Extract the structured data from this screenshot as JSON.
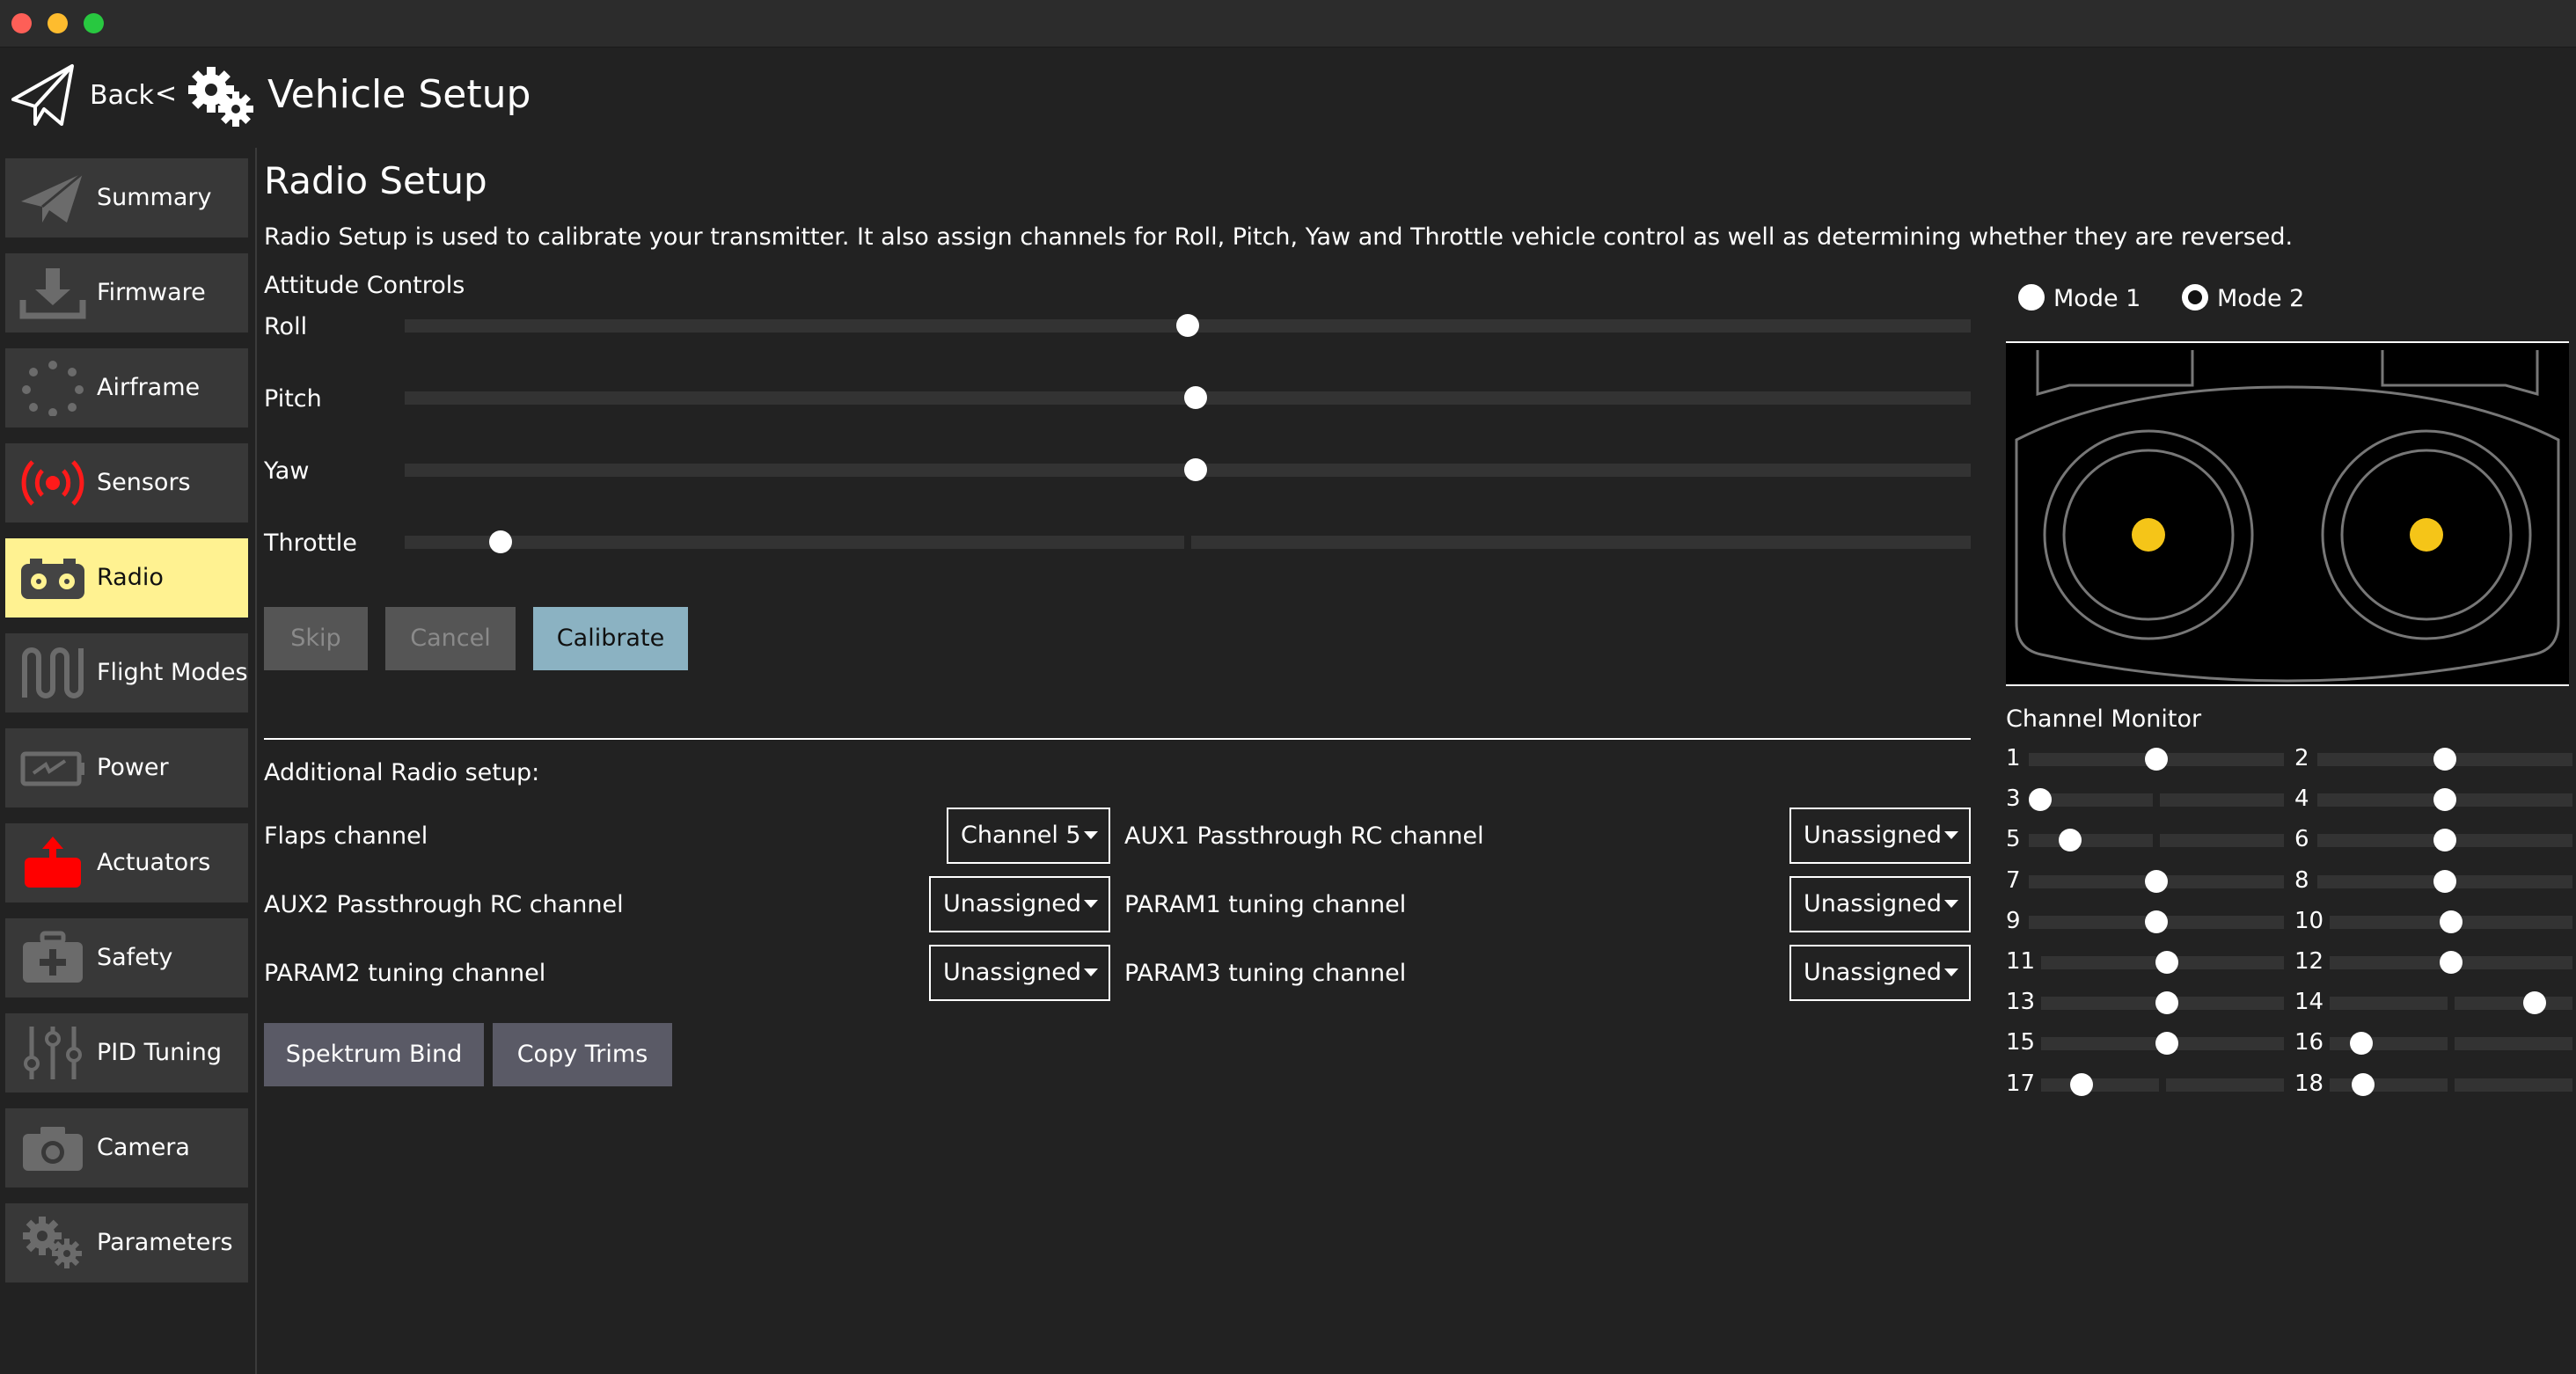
{
  "colors": {
    "background": "#222222",
    "panel": "#383838",
    "active": "#fff291",
    "accent": "#8bb2c2",
    "stick": "#f5c518",
    "red_icon": "#ff0000"
  },
  "header": {
    "back_label": "Back",
    "separator": "<",
    "title": "Vehicle Setup"
  },
  "sidebar": {
    "items": [
      {
        "label": "Summary",
        "icon": "paper-plane-icon"
      },
      {
        "label": "Firmware",
        "icon": "download-icon"
      },
      {
        "label": "Airframe",
        "icon": "airframe-dots-icon"
      },
      {
        "label": "Sensors",
        "icon": "sensors-icon"
      },
      {
        "label": "Radio",
        "icon": "radio-transmitter-icon",
        "active": true
      },
      {
        "label": "Flight Modes",
        "icon": "flight-modes-icon"
      },
      {
        "label": "Power",
        "icon": "battery-icon"
      },
      {
        "label": "Actuators",
        "icon": "actuators-icon"
      },
      {
        "label": "Safety",
        "icon": "first-aid-icon"
      },
      {
        "label": "PID Tuning",
        "icon": "sliders-icon"
      },
      {
        "label": "Camera",
        "icon": "camera-icon"
      },
      {
        "label": "Parameters",
        "icon": "gears-icon"
      }
    ]
  },
  "radio": {
    "title": "Radio Setup",
    "description": "Radio Setup is used to calibrate your transmitter. It also assign channels for Roll, Pitch, Yaw and Throttle vehicle control as well as determining whether they are reversed.",
    "attitude_heading": "Attitude Controls",
    "controls": [
      {
        "label": "Roll",
        "value": 0.5
      },
      {
        "label": "Pitch",
        "value": 0.505
      },
      {
        "label": "Yaw",
        "value": 0.505
      },
      {
        "label": "Throttle",
        "value": 0.055
      }
    ],
    "buttons": {
      "skip": "Skip",
      "cancel": "Cancel",
      "calibrate": "Calibrate"
    },
    "modes": {
      "mode1": "Mode 1",
      "mode2": "Mode 2",
      "selected": "mode2"
    },
    "channel_monitor_title": "Channel Monitor",
    "channels": [
      {
        "n": "1",
        "value": 0.5
      },
      {
        "n": "2",
        "value": 0.5
      },
      {
        "n": "3",
        "value": 0.0
      },
      {
        "n": "4",
        "value": 0.5
      },
      {
        "n": "5",
        "value": 0.13
      },
      {
        "n": "6",
        "value": 0.5
      },
      {
        "n": "7",
        "value": 0.5
      },
      {
        "n": "8",
        "value": 0.5
      },
      {
        "n": "9",
        "value": 0.5
      },
      {
        "n": "10",
        "value": 0.5
      },
      {
        "n": "11",
        "value": 0.52
      },
      {
        "n": "12",
        "value": 0.5
      },
      {
        "n": "13",
        "value": 0.52
      },
      {
        "n": "14",
        "value": 0.88
      },
      {
        "n": "15",
        "value": 0.52
      },
      {
        "n": "16",
        "value": 0.09
      },
      {
        "n": "17",
        "value": 0.13
      },
      {
        "n": "18",
        "value": 0.1
      }
    ],
    "additional": {
      "heading": "Additional Radio setup:",
      "flaps_label": "Flaps channel",
      "flaps_value": "Channel 5",
      "aux1_label": "AUX1 Passthrough RC channel",
      "aux1_value": "Unassigned",
      "aux2_label": "AUX2 Passthrough RC channel",
      "aux2_value": "Unassigned",
      "param1_label": "PARAM1 tuning channel",
      "param1_value": "Unassigned",
      "param2_label": "PARAM2 tuning channel",
      "param2_value": "Unassigned",
      "param3_label": "PARAM3 tuning channel",
      "param3_value": "Unassigned"
    },
    "bottom_buttons": {
      "spektrum": "Spektrum Bind",
      "copy_trims": "Copy Trims"
    }
  }
}
